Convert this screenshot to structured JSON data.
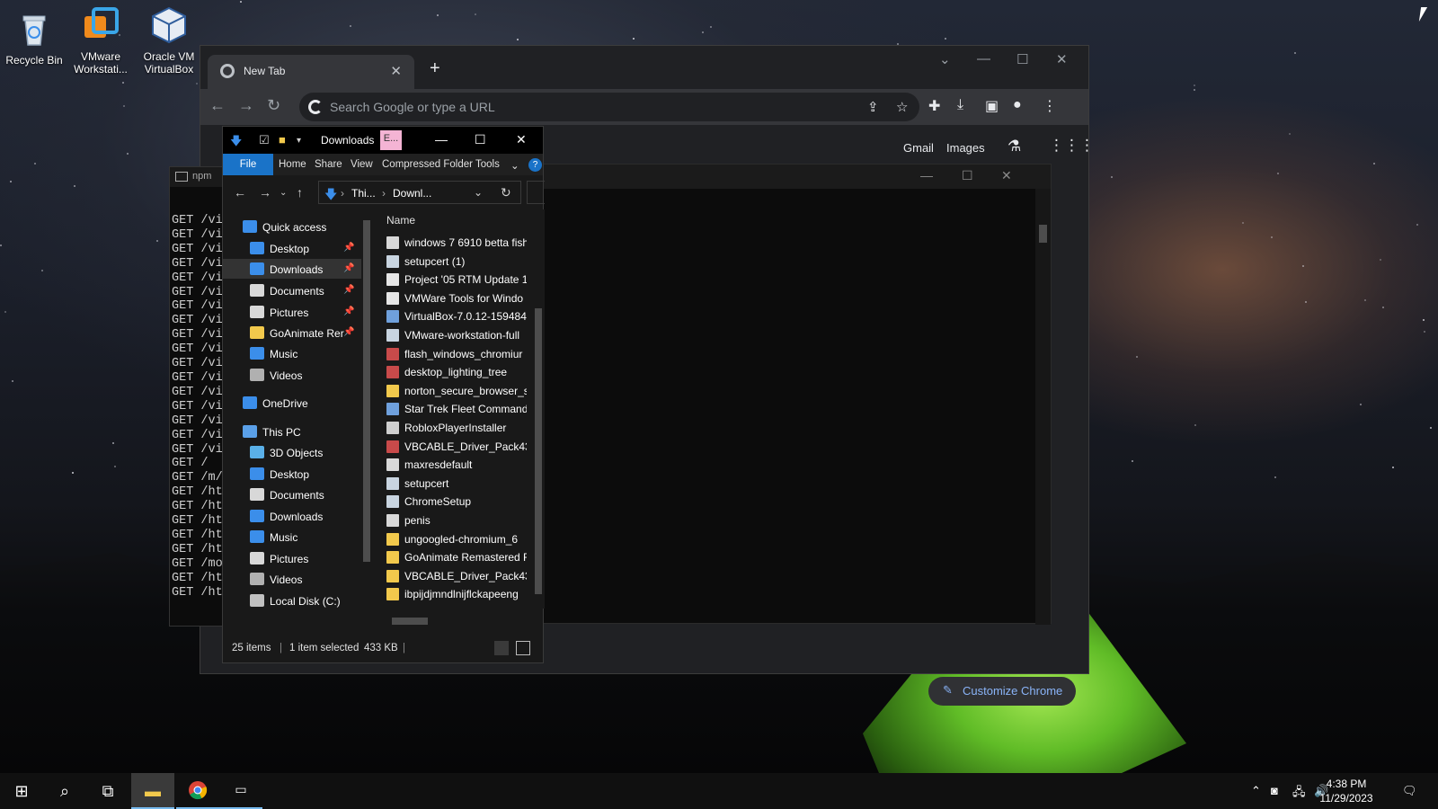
{
  "desktop": {
    "icons": [
      {
        "label": "Recycle Bin",
        "icon": "recycle-bin-icon"
      },
      {
        "label": "VMware Workstati...",
        "icon": "vmware-icon"
      },
      {
        "label": "Oracle VM VirtualBox",
        "icon": "virtualbox-icon"
      }
    ]
  },
  "chrome": {
    "tab_title": "New Tab",
    "omnibox_placeholder": "Search Google or type a URL",
    "ntp_links": [
      "Gmail",
      "Images"
    ],
    "customize_label": "Customize Chrome",
    "accent_color": "#8ab4f8"
  },
  "terminal": {
    "title": "npm",
    "lines": [
      "GET /vi",
      "GET /vi",
      "GET /vi",
      "GET /vi",
      "GET /vi",
      "GET /vi",
      "GET /vi",
      "GET /vi",
      "GET /vi",
      "GET /vi",
      "GET /vi",
      "GET /vi",
      "GET /vi",
      "GET /vi",
      "GET /vi",
      "GET /vi",
      "GET /vi",
      "GET /",
      "GET /m/",
      "GET /ht",
      "GET /ht",
      "GET /ht",
      "GET /ht",
      "GET /ht",
      "GET /mo",
      "GET /ht",
      "GET /ht"
    ]
  },
  "explorer": {
    "title": "Downloads",
    "context_tab_short": "E...",
    "ribbon_tabs": [
      "File",
      "Home",
      "Share",
      "View",
      "Compressed Folder Tools"
    ],
    "breadcrumb": [
      "Thi...",
      "Downl..."
    ],
    "column_header": "Name",
    "nav_items": [
      {
        "label": "Quick access",
        "icon": "star-icon",
        "pinned": false
      },
      {
        "label": "Desktop",
        "icon": "desktop-folder-icon",
        "pinned": true
      },
      {
        "label": "Downloads",
        "icon": "downloads-folder-icon",
        "pinned": true,
        "selected": true
      },
      {
        "label": "Documents",
        "icon": "documents-folder-icon",
        "pinned": true
      },
      {
        "label": "Pictures",
        "icon": "pictures-folder-icon",
        "pinned": true
      },
      {
        "label": "GoAnimate Rer",
        "icon": "folder-icon",
        "pinned": true
      },
      {
        "label": "Music",
        "icon": "music-folder-icon",
        "pinned": false
      },
      {
        "label": "Videos",
        "icon": "videos-folder-icon",
        "pinned": false
      },
      {
        "label": "OneDrive",
        "icon": "onedrive-icon",
        "pinned": false
      },
      {
        "label": "This PC",
        "icon": "this-pc-icon",
        "pinned": false
      },
      {
        "label": "3D Objects",
        "icon": "3d-objects-icon",
        "pinned": false
      },
      {
        "label": "Desktop",
        "icon": "desktop-folder-icon",
        "pinned": false
      },
      {
        "label": "Documents",
        "icon": "documents-folder-icon",
        "pinned": false
      },
      {
        "label": "Downloads",
        "icon": "downloads-folder-icon",
        "pinned": false
      },
      {
        "label": "Music",
        "icon": "music-folder-icon",
        "pinned": false
      },
      {
        "label": "Pictures",
        "icon": "pictures-folder-icon",
        "pinned": false
      },
      {
        "label": "Videos",
        "icon": "videos-folder-icon",
        "pinned": false
      },
      {
        "label": "Local Disk (C:)",
        "icon": "local-disk-icon",
        "pinned": false
      }
    ],
    "files": [
      {
        "name": "windows 7 6910 betta fish",
        "icon": "image-file-icon"
      },
      {
        "name": "setupcert (1)",
        "icon": "installer-file-icon"
      },
      {
        "name": "Project '05 RTM Update 1",
        "icon": "document-file-icon"
      },
      {
        "name": "VMWare Tools for Windo",
        "icon": "document-file-icon"
      },
      {
        "name": "VirtualBox-7.0.12-159484-",
        "icon": "virtualbox-file-icon"
      },
      {
        "name": "VMware-workstation-full",
        "icon": "installer-file-icon"
      },
      {
        "name": "flash_windows_chromiur",
        "icon": "archive-file-icon"
      },
      {
        "name": "desktop_lighting_tree",
        "icon": "archive-file-icon"
      },
      {
        "name": "norton_secure_browser_s",
        "icon": "norton-file-icon"
      },
      {
        "name": "Star Trek Fleet Command",
        "icon": "app-file-icon"
      },
      {
        "name": "RobloxPlayerInstaller",
        "icon": "roblox-file-icon"
      },
      {
        "name": "VBCABLE_Driver_Pack43",
        "icon": "archive-file-icon"
      },
      {
        "name": "maxresdefault",
        "icon": "image-file-icon"
      },
      {
        "name": "setupcert",
        "icon": "installer-file-icon"
      },
      {
        "name": "ChromeSetup",
        "icon": "installer-file-icon"
      },
      {
        "name": "penis",
        "icon": "image-file-icon"
      },
      {
        "name": "ungoogled-chromium_6",
        "icon": "folder-icon"
      },
      {
        "name": "GoAnimate Remastered F",
        "icon": "folder-icon"
      },
      {
        "name": "VBCABLE_Driver_Pack43",
        "icon": "folder-icon"
      },
      {
        "name": "ibpijdjmndlnijflckapeeng",
        "icon": "folder-icon"
      }
    ],
    "status": {
      "item_count": "25 items",
      "selection": "1 item selected",
      "size": "433 KB"
    }
  },
  "taskbar": {
    "time": "4:38 PM",
    "date": "11/29/2023"
  }
}
